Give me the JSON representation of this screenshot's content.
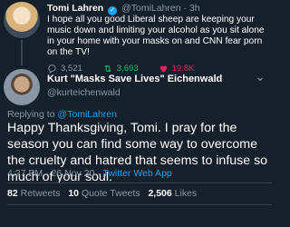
{
  "tweet1": {
    "name": "Tomi Lahren",
    "handle": "@TomiLahren",
    "time": "3h",
    "text": "I hope all you good Liberal sheep are keeping your music down and limiting your alcohol as you sit alone in your home with your masks on and CNN fear porn on the TV!",
    "replies": "3,521",
    "retweets": "3,693",
    "likes": "19.8K"
  },
  "tweet2": {
    "name": "Kurt \"Masks Save Lives\" Eichenwald",
    "handle": "@kurteichenwald",
    "replying_label": "Replying to",
    "replying_to": "@TomiLahren",
    "text": "Happy Thanksgiving, Tomi. I pray for the season you can find some way to overcome the cruelty and hatred that seems to infuse so much of your soul.",
    "time": "4:27 PM",
    "date": "26 Nov 20",
    "source": "Twitter Web App",
    "retweets_count": "82",
    "retweets_label": "Retweets",
    "quotes_count": "10",
    "quotes_label": "Quote Tweets",
    "likes_count": "2,506",
    "likes_label": "Likes"
  },
  "colors": {
    "background": "#15202b",
    "accent": "#1da1f2",
    "retweet": "#17bf63",
    "like": "#e0245e",
    "muted": "#8899a6"
  },
  "icons": [
    "verified-badge-icon",
    "reply-icon",
    "retweet-icon",
    "like-icon",
    "more-icon"
  ]
}
